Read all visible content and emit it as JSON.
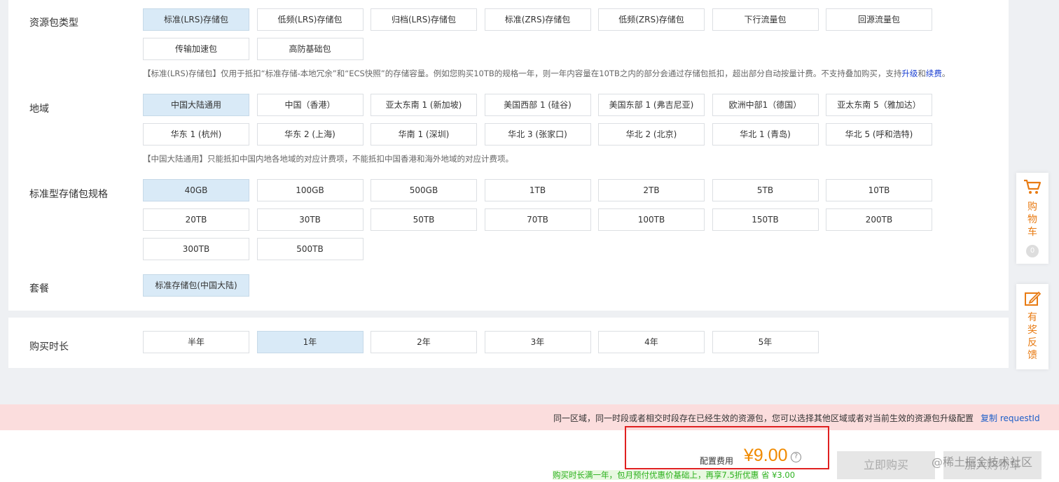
{
  "resource_type": {
    "label": "资源包类型",
    "options": [
      "标准(LRS)存储包",
      "低频(LRS)存储包",
      "归档(LRS)存储包",
      "标准(ZRS)存储包",
      "低频(ZRS)存储包",
      "下行流量包",
      "回源流量包",
      "传输加速包",
      "高防基础包"
    ],
    "selected": "标准(LRS)存储包",
    "hint_main": "【标准(LRS)存储包】仅用于抵扣“标准存储-本地冗余”和“ECS快照”的存储容量。例如您购买10TB的规格一年，则一年内容量在10TB之内的部分会通过存储包抵扣，超出部分自动按量计费。不支持叠加购买，支持",
    "hint_upgrade": "升级",
    "hint_and": "和",
    "hint_renew": "续费",
    "hint_end": "。"
  },
  "region": {
    "label": "地域",
    "options": [
      "中国大陆通用",
      "中国（香港）",
      "亚太东南 1 (新加坡)",
      "美国西部 1 (硅谷)",
      "美国东部 1 (弗吉尼亚)",
      "欧洲中部1（德国）",
      "亚太东南 5（雅加达）",
      "华东 1 (杭州)",
      "华东 2 (上海)",
      "华南 1 (深圳)",
      "华北 3 (张家口)",
      "华北 2 (北京)",
      "华北 1 (青岛)",
      "华北 5 (呼和浩特)"
    ],
    "selected": "中国大陆通用",
    "hint": "【中国大陆通用】只能抵扣中国内地各地域的对应计费项，不能抵扣中国香港和海外地域的对应计费项。"
  },
  "spec": {
    "label": "标准型存储包规格",
    "options": [
      "40GB",
      "100GB",
      "500GB",
      "1TB",
      "2TB",
      "5TB",
      "10TB",
      "20TB",
      "30TB",
      "50TB",
      "70TB",
      "100TB",
      "150TB",
      "200TB",
      "300TB",
      "500TB"
    ],
    "selected": "40GB"
  },
  "package": {
    "label": "套餐",
    "options": [
      "标准存储包(中国大陆)"
    ],
    "selected": "标准存储包(中国大陆)"
  },
  "duration": {
    "label": "购买时长",
    "options": [
      "半年",
      "1年",
      "2年",
      "3年",
      "4年",
      "5年"
    ],
    "selected": "1年"
  },
  "side": {
    "cart_chars": [
      "购",
      "物",
      "车"
    ],
    "cart_count": "0",
    "feedback_chars": [
      "有",
      "奖",
      "反",
      "馈"
    ]
  },
  "warning": {
    "text": "同一区域，同一时段或者相交时段存在已经生效的资源包，您可以选择其他区域或者对当前生效的资源包升级配置",
    "link": "复制 requestId"
  },
  "footer": {
    "price_label": "配置费用",
    "price_value": "¥9.00",
    "help": "?",
    "promo_green": "购买时长满一年，包月预付优惠价基础上，再享7.5折优惠",
    "promo_saving": "省 ¥3.00",
    "buy_now": "立即购买",
    "add_cart": "加入购物车",
    "watermark": "@稀土掘金技术社区"
  },
  "colors": {
    "selected_bg": "#d9eaf7",
    "price": "#f08a00",
    "accent_orange": "#e87b13",
    "link_blue": "#1a3fd1",
    "warn_bg": "#fbdddd",
    "highlight_border": "#e02020"
  }
}
